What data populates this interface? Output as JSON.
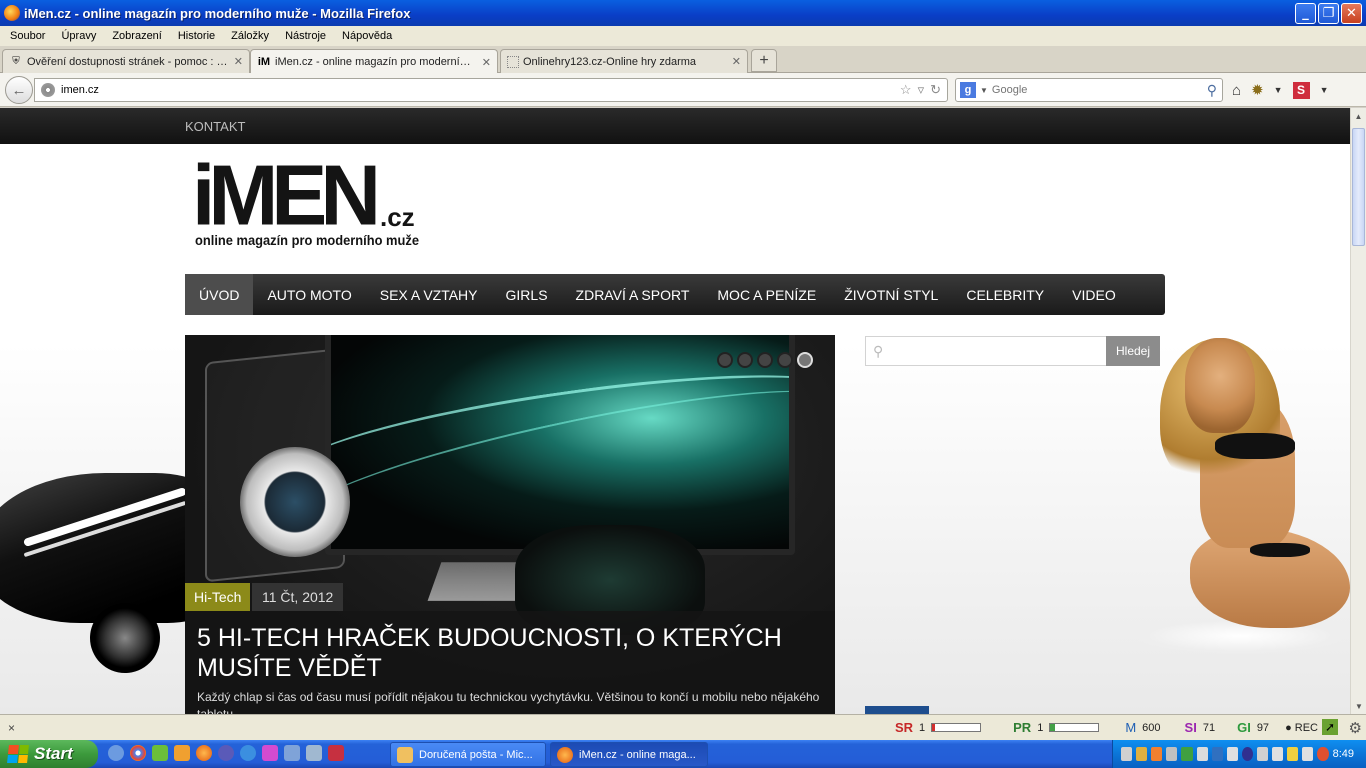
{
  "window": {
    "title": "iMen.cz - online magazín pro moderního muže - Mozilla Firefox",
    "minimize": "_",
    "restore": "❐",
    "close": "✕"
  },
  "menu": [
    "Soubor",
    "Úpravy",
    "Zobrazení",
    "Historie",
    "Záložky",
    "Nástroje",
    "Nápověda"
  ],
  "tabs": [
    {
      "label": "Ověření dostupnosti stránek - pomoc : V...",
      "icon": "shield-icon",
      "close": "✕",
      "active": false
    },
    {
      "label": "iMen.cz - online magazín pro moderního ...",
      "icon": "imen-favicon",
      "close": "✕",
      "active": true
    },
    {
      "label": "Onlinehry123.cz-Online hry zdarma",
      "icon": "blank-page-icon",
      "close": "✕",
      "active": false
    }
  ],
  "newtab": "+",
  "nav": {
    "url": "imen.cz",
    "search_placeholder": "Google",
    "search_engine_letter": "g"
  },
  "site": {
    "topbar_link": "KONTAKT",
    "logo_main": "iMEN",
    "logo_tld": ".cz",
    "logo_tagline": "online magazín pro moderního muže",
    "menu": [
      "ÚVOD",
      "AUTO MOTO",
      "SEX A VZTAHY",
      "GIRLS",
      "ZDRAVÍ A SPORT",
      "MOC A PENÍZE",
      "ŽIVOTNÍ STYL",
      "CELEBRITY",
      "VIDEO"
    ],
    "active_menu": 0,
    "slide": {
      "category": "Hi-Tech",
      "date": "11 Čt, 2012",
      "headline": "5 HI-TECH HRAČEK BUDOUCNOSTI, O KTERÝCH MUSÍTE VĚDĚT",
      "excerpt": "Každý chlap si čas od času musí pořídit nějakou tu technickou vychytávku. Většinou to končí u mobilu nebo nějakého tabletu.",
      "dots": 5,
      "active_dot": 4
    },
    "search_button": "Hledej",
    "search_placeholder": ""
  },
  "status": {
    "close": "×",
    "sr_label": "SR",
    "sr_value": "1",
    "sr_fill": 0.05,
    "pr_label": "PR",
    "pr_value": "1",
    "pr_fill": 0.1,
    "m_label": "M",
    "m_value": "600",
    "si_label": "SI",
    "si_value": "71",
    "gi_label": "GI",
    "gi_value": "97",
    "rec": "● REC"
  },
  "taskbar": {
    "start": "Start",
    "tasks": [
      {
        "label": "Doručená pošta - Mic...",
        "active": false
      },
      {
        "label": "iMen.cz - online maga...",
        "active": true
      }
    ],
    "clock": "8:49"
  },
  "colors": {
    "tag_bg": "#8c8a19",
    "nav_bg": "#1a1a1a",
    "xp_blue": "#245dd7"
  }
}
